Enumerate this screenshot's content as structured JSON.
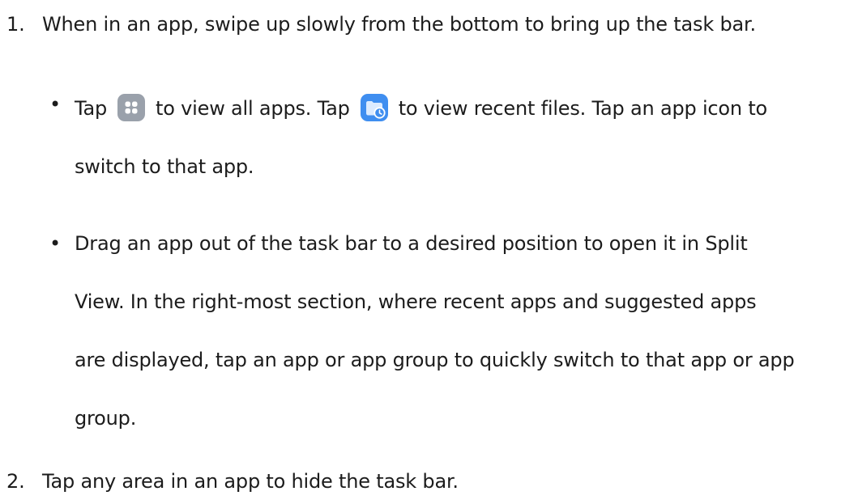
{
  "steps": [
    {
      "number": "1.",
      "text": "When in an app, swipe up slowly from the bottom to bring up the task bar.",
      "bullets": [
        {
          "dot": "•",
          "line1_part1": "Tap",
          "icon1": "all-apps-icon",
          "line1_part2": "to view all apps. Tap",
          "icon2": "recent-files-icon",
          "line1_part3": "to view recent files. Tap an app icon to",
          "line2": "switch to that app."
        },
        {
          "dot": "•",
          "lines": [
            "Drag an app out of the task bar to a desired position to open it in Split",
            "View. In the right-most section, where recent apps and suggested apps",
            "are displayed, tap an app or app group to quickly switch to that app or app",
            "group."
          ]
        }
      ]
    },
    {
      "number": "2.",
      "text": "Tap any area in an app to hide the task bar."
    }
  ],
  "colors": {
    "text": "#1c1c1c",
    "all_apps_icon_bg": "#9aa1ab",
    "recent_files_icon_bg": "#3f8ef0"
  }
}
